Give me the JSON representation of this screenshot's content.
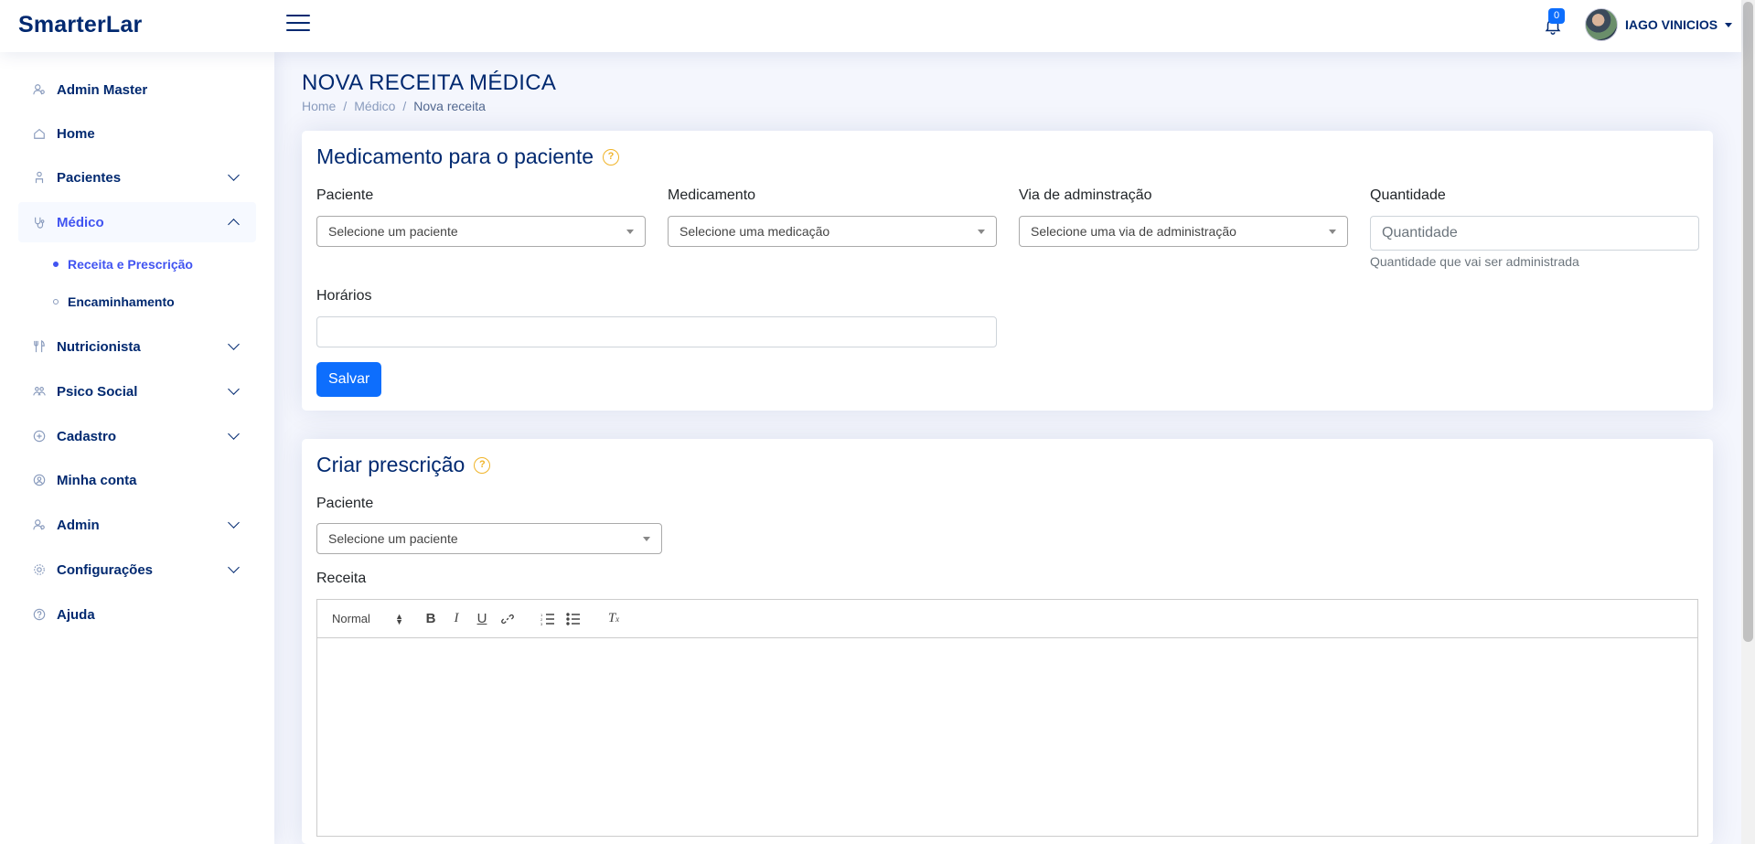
{
  "header": {
    "logo": "SmarterLar",
    "notification_count": "0",
    "user_name": "IAGO VINICIOS"
  },
  "sidebar": {
    "items": [
      {
        "label": "Admin Master",
        "icon": "user-admin-icon"
      },
      {
        "label": "Home",
        "icon": "home-icon"
      },
      {
        "label": "Pacientes",
        "icon": "patient-icon"
      },
      {
        "label": "Médico",
        "icon": "stethoscope-icon"
      },
      {
        "label": "Nutricionista",
        "icon": "cutlery-icon"
      },
      {
        "label": "Psico Social",
        "icon": "people-icon"
      },
      {
        "label": "Cadastro",
        "icon": "plus-circle-icon"
      },
      {
        "label": "Minha conta",
        "icon": "user-circle-icon"
      },
      {
        "label": "Admin",
        "icon": "user-admin-icon"
      },
      {
        "label": "Configurações",
        "icon": "gear-icon"
      },
      {
        "label": "Ajuda",
        "icon": "question-circle-icon"
      }
    ],
    "subitems": [
      {
        "label": "Receita e Prescrição"
      },
      {
        "label": "Encaminhamento"
      }
    ]
  },
  "page": {
    "title": "NOVA RECEITA MÉDICA",
    "breadcrumb": [
      "Home",
      "Médico",
      "Nova receita"
    ]
  },
  "card1": {
    "title": "Medicamento para o paciente",
    "paciente_label": "Paciente",
    "paciente_value": "Selecione um paciente",
    "medicamento_label": "Medicamento",
    "medicamento_value": "Selecione uma medicação",
    "via_label": "Via de adminstração",
    "via_value": "Selecione uma via de administração",
    "quantidade_label": "Quantidade",
    "quantidade_placeholder": "Quantidade",
    "quantidade_help": "Quantidade que vai ser administrada",
    "horarios_label": "Horários",
    "save_label": "Salvar"
  },
  "card2": {
    "title": "Criar prescrição",
    "paciente_label": "Paciente",
    "paciente_value": "Selecione um paciente",
    "receita_label": "Receita",
    "editor_format": "Normal"
  },
  "colors": {
    "primary": "#0d6efd",
    "brand": "#012970",
    "help_icon": "#f0b429"
  }
}
